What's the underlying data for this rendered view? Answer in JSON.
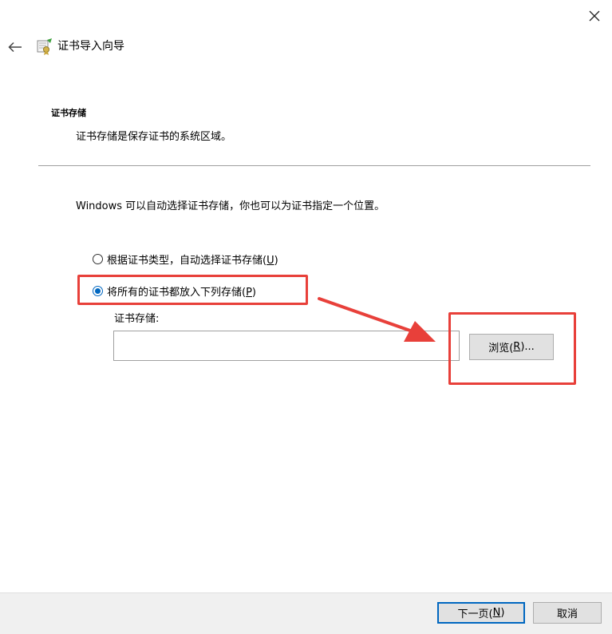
{
  "window": {
    "close_icon": "close-icon",
    "back_icon": "arrow-left-icon",
    "wizard_icon": "certificate-wizard-icon",
    "title": "证书导入向导"
  },
  "section": {
    "heading": "证书存储",
    "description": "证书存储是保存证书的系统区域。"
  },
  "intro": "Windows 可以自动选择证书存储，你也可以为证书指定一个位置。",
  "options": [
    {
      "label_before": "根据证书类型，自动选择证书存储(",
      "accel": "U",
      "label_after": ")",
      "checked": false
    },
    {
      "label_before": "将所有的证书都放入下列存储(",
      "accel": "P",
      "label_after": ")",
      "checked": true
    }
  ],
  "store": {
    "label": "证书存储:",
    "value": "",
    "browse_before": "浏览(",
    "browse_accel": "R",
    "browse_after": ")..."
  },
  "footer": {
    "next_before": "下一页(",
    "next_accel": "N",
    "next_after": ")",
    "cancel": "取消"
  },
  "colors": {
    "accent": "#0067c0",
    "annotation": "#e8403a",
    "footer_bg": "#f0f0f0"
  }
}
